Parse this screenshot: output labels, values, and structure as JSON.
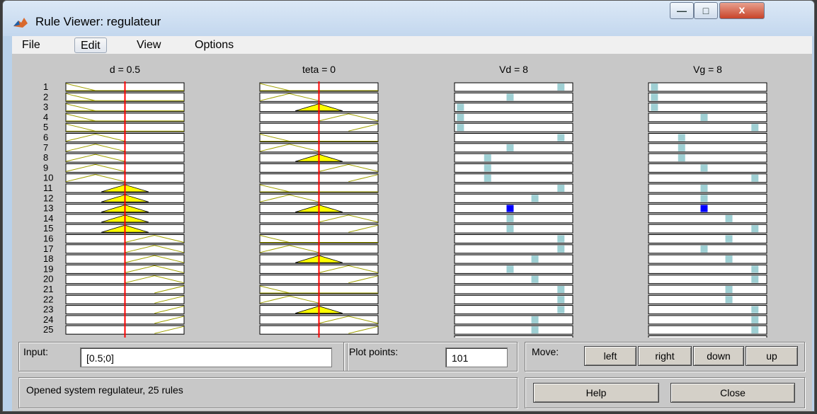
{
  "window": {
    "title": "Rule Viewer: regulateur",
    "close_glyph": "x"
  },
  "menu": [
    "File",
    "Edit",
    "View",
    "Options"
  ],
  "columns": [
    {
      "label": "d = 0.5",
      "type": "input",
      "value": 0.5
    },
    {
      "label": "teta = 0",
      "type": "input",
      "value": 0
    },
    {
      "label": "Vd = 8",
      "type": "output",
      "value": 8
    },
    {
      "label": "Vg = 8",
      "type": "output",
      "value": 8
    }
  ],
  "rule_numbers": [
    "1",
    "2",
    "3",
    "4",
    "5",
    "6",
    "7",
    "8",
    "9",
    "10",
    "11",
    "12",
    "13",
    "14",
    "15",
    "16",
    "17",
    "18",
    "19",
    "20",
    "21",
    "22",
    "23",
    "24",
    "25"
  ],
  "rules": {
    "d_mf": [
      "L",
      "L",
      "L",
      "L",
      "L",
      "M",
      "M",
      "M",
      "M",
      "M",
      "Z",
      "Z",
      "Z",
      "Z",
      "Z",
      "P",
      "P",
      "P",
      "P",
      "P",
      "R",
      "R",
      "R",
      "R",
      "R"
    ],
    "teta_mf": [
      "L",
      "M",
      "Z",
      "P",
      "R",
      "L",
      "M",
      "Z",
      "P",
      "R",
      "L",
      "M",
      "Z",
      "P",
      "R",
      "L",
      "M",
      "Z",
      "P",
      "R",
      "L",
      "M",
      "Z",
      "P",
      "R"
    ],
    "d_fired": [
      false,
      false,
      false,
      false,
      false,
      false,
      false,
      false,
      false,
      false,
      true,
      true,
      true,
      true,
      true,
      false,
      false,
      false,
      false,
      false,
      false,
      false,
      false,
      false,
      false
    ],
    "teta_fired": [
      false,
      false,
      true,
      false,
      false,
      false,
      false,
      true,
      false,
      false,
      false,
      false,
      true,
      false,
      false,
      false,
      false,
      true,
      false,
      false,
      false,
      false,
      true,
      false,
      false
    ],
    "vd_pos": [
      0.9,
      0.47,
      0.05,
      0.05,
      0.05,
      0.9,
      0.47,
      0.28,
      0.28,
      0.28,
      0.9,
      0.68,
      0.47,
      0.47,
      0.47,
      0.9,
      0.9,
      0.68,
      0.47,
      0.68,
      0.9,
      0.9,
      0.9,
      0.68,
      0.68
    ],
    "vg_pos": [
      0.05,
      0.05,
      0.05,
      0.47,
      0.9,
      0.28,
      0.28,
      0.28,
      0.47,
      0.9,
      0.47,
      0.47,
      0.47,
      0.68,
      0.9,
      0.68,
      0.47,
      0.68,
      0.9,
      0.9,
      0.68,
      0.68,
      0.9,
      0.9,
      0.9
    ],
    "active_rule_index": 12
  },
  "colors": {
    "fired": "#ffff00",
    "inactive_mf": "#a0a000",
    "marker": "#9ecfd3",
    "marker_active": "#0000ff",
    "cursor": "#ff0000"
  },
  "controls": {
    "input_label": "Input:",
    "input_value": "[0.5;0]",
    "plot_points_label": "Plot points:",
    "plot_points_value": "101",
    "move_label": "Move:",
    "move_buttons": [
      "left",
      "right",
      "down",
      "up"
    ],
    "status": "Opened system regulateur, 25 rules",
    "help_label": "Help",
    "close_label": "Close"
  }
}
